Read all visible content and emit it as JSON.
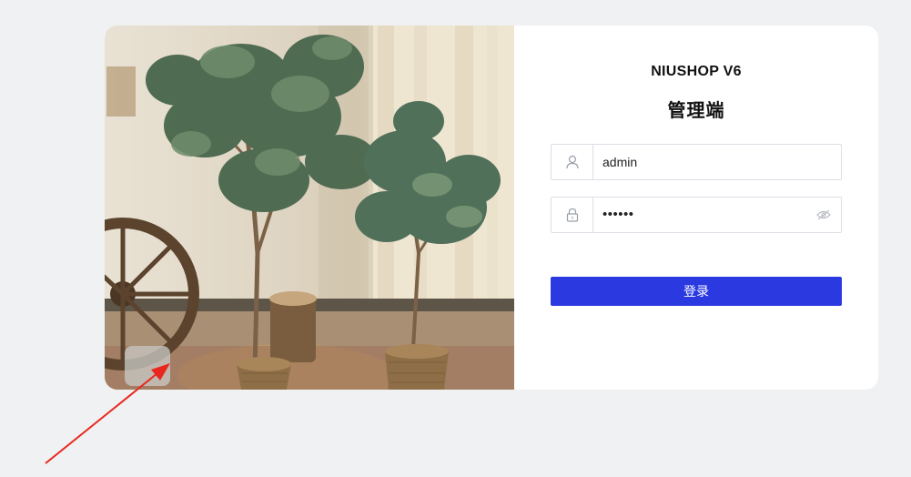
{
  "login": {
    "brand": "NIUSHOP V6",
    "subtitle": "管理端",
    "username": {
      "value": "admin",
      "icon": "user-icon"
    },
    "password": {
      "masked_value": "••••••",
      "icon": "lock-icon",
      "toggle_icon": "eye-hidden-icon"
    },
    "submit_label": "登录"
  },
  "colors": {
    "page_background": "#f0f1f3",
    "primary_button": "#2a3ae0",
    "annotation_arrow": "#e8281e"
  }
}
